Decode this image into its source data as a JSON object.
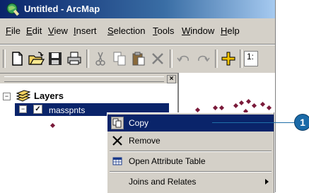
{
  "window": {
    "title": "Untitled - ArcMap"
  },
  "menu": [
    {
      "label_ul": "F",
      "label_rest": "ile"
    },
    {
      "label_ul": "E",
      "label_rest": "dit"
    },
    {
      "label_ul": "V",
      "label_rest": "iew"
    },
    {
      "label_ul": "I",
      "label_rest": "nsert"
    },
    {
      "label_ul": "S",
      "label_rest": "election"
    },
    {
      "label_ul": "T",
      "label_rest": "ools"
    },
    {
      "label_ul": "W",
      "label_rest": "indow"
    },
    {
      "label_ul": "H",
      "label_rest": "elp"
    }
  ],
  "toolbar": {
    "scale_text": "1:"
  },
  "toc": {
    "close_glyph": "×",
    "layers_label": "Layers",
    "layer_name": "masspnts",
    "expand_glyph": "⊟",
    "collapse_glyph": "−",
    "check_glyph": "✓"
  },
  "context_menu": {
    "items": [
      {
        "label": "Copy",
        "highlighted": true,
        "icon": "copy-icon"
      },
      {
        "label": "Remove",
        "icon": "remove-icon"
      },
      {
        "label": "Open Attribute Table",
        "icon": "table-icon"
      },
      {
        "label": "Joins and Relates",
        "icon": "",
        "submenu": true
      }
    ]
  },
  "callout": {
    "number": "1",
    "color": "#1a6aa8"
  },
  "colors": {
    "selection": "#0a246a",
    "point_symbol": "#7a1a3a"
  }
}
